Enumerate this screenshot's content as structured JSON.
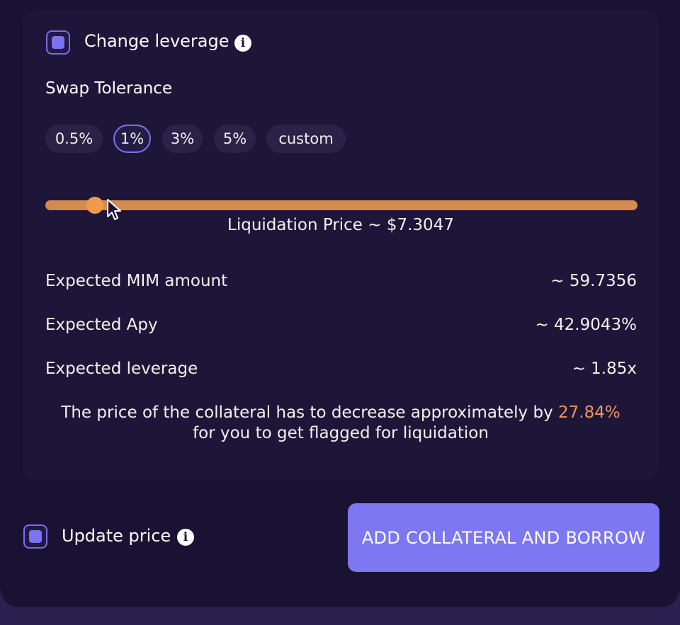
{
  "leverage": {
    "checkbox_checked": true,
    "label": "Change leverage",
    "info_icon": "info-icon"
  },
  "swap_tolerance": {
    "title": "Swap Tolerance",
    "options": [
      "0.5%",
      "1%",
      "3%",
      "5%",
      "custom"
    ],
    "selected": "1%"
  },
  "slider": {
    "value_fraction": 0.085,
    "liquidation_label": "Liquidation Price ~ $7.3047"
  },
  "stats": [
    {
      "label": "Expected MIM amount",
      "value": "~ 59.7356"
    },
    {
      "label": "Expected Apy",
      "value": "~ 42.9043%"
    },
    {
      "label": "Expected leverage",
      "value": "~ 1.85x"
    }
  ],
  "warning": {
    "text_before": "The price of the collateral has to decrease approximately by ",
    "percent": "27.84%",
    "text_after": "for you to get flagged for liquidation"
  },
  "update_price": {
    "checkbox_checked": true,
    "label": "Update price",
    "info_icon": "info-icon"
  },
  "action_button": {
    "label": "ADD COLLATERAL AND BORROW"
  },
  "colors": {
    "accent": "#7d77f2",
    "slider": "#d38b4e",
    "highlight": "#f0955a",
    "background": "#1a1232"
  }
}
